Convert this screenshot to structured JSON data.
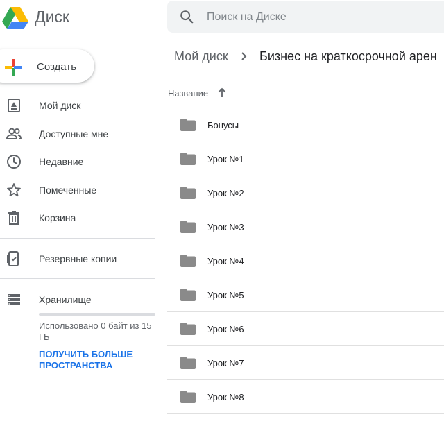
{
  "app": {
    "name": "Диск"
  },
  "search": {
    "placeholder": "Поиск на Диске"
  },
  "create": {
    "label": "Создать"
  },
  "sidebar": {
    "items": [
      {
        "label": "Мой диск",
        "icon": "my-drive-icon"
      },
      {
        "label": "Доступные мне",
        "icon": "shared-people-icon"
      },
      {
        "label": "Недавние",
        "icon": "clock-icon"
      },
      {
        "label": "Помеченные",
        "icon": "star-icon"
      },
      {
        "label": "Корзина",
        "icon": "trash-icon"
      },
      {
        "label": "Резервные копии",
        "icon": "backup-device-icon"
      },
      {
        "label": "Хранилище",
        "icon": "storage-icon"
      }
    ],
    "storage_text": "Использовано 0 байт из 15 ГБ",
    "storage_link": "ПОЛУЧИТЬ БОЛЬШЕ ПРОСТРАНСТВА",
    "storage_used_fraction": 0
  },
  "breadcrumb": {
    "root": "Мой диск",
    "current": "Бизнес на краткосрочной арен"
  },
  "list": {
    "column_header": "Название",
    "rows": [
      {
        "name": "Бонусы"
      },
      {
        "name": "Урок №1"
      },
      {
        "name": "Урок №2"
      },
      {
        "name": "Урок №3"
      },
      {
        "name": "Урок №4"
      },
      {
        "name": "Урок №5"
      },
      {
        "name": "Урок №6"
      },
      {
        "name": "Урок №7"
      },
      {
        "name": "Урок №8"
      }
    ]
  },
  "colors": {
    "accent_link": "#1a73e8",
    "folder": "#8a8a8a",
    "search_bg": "#f1f3f4"
  }
}
